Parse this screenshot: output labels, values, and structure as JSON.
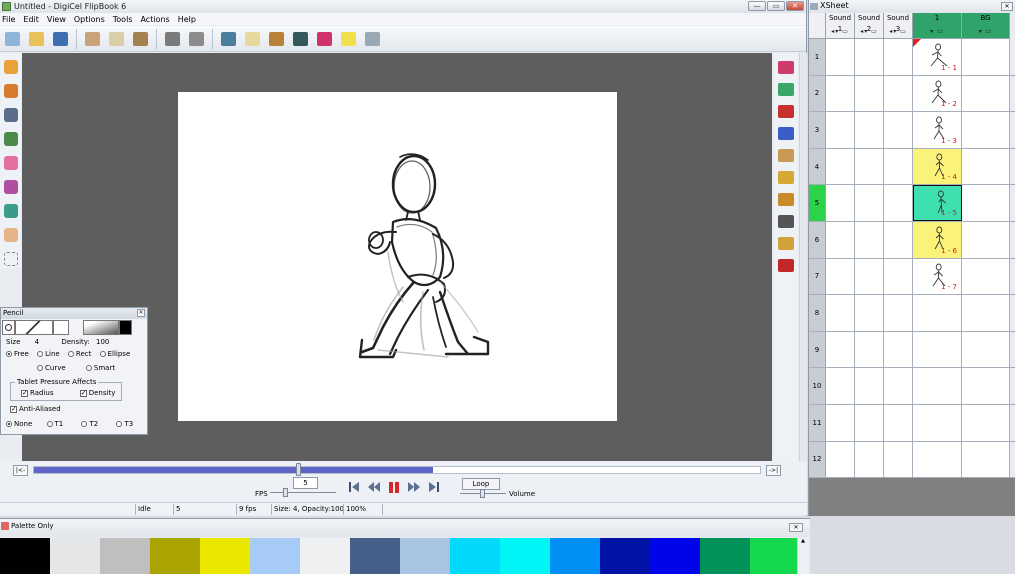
{
  "main_window": {
    "title": "Untitled - DigiCel FlipBook 6",
    "menu": [
      "File",
      "Edit",
      "View",
      "Options",
      "Tools",
      "Actions",
      "Help"
    ]
  },
  "toolbar": {
    "buttons": [
      {
        "icon": "camera-icon",
        "color": "#8fb4d9"
      },
      {
        "icon": "open-folder-icon",
        "color": "#e8c15a"
      },
      {
        "icon": "save-disk-icon",
        "color": "#3d6fb3"
      },
      {
        "icon": "scissors-icon",
        "color": "#c9a27a"
      },
      {
        "icon": "copy-icon",
        "color": "#d9cfa8"
      },
      {
        "icon": "paste-icon",
        "color": "#a58150"
      },
      {
        "icon": "undo-hand-icon",
        "color": "#7b7b7b"
      },
      {
        "icon": "redo-hand-icon",
        "color": "#8b8b8b"
      },
      {
        "icon": "lightbox-icon",
        "color": "#4c7d9c"
      },
      {
        "icon": "eraser-icon",
        "color": "#e6d79b"
      },
      {
        "icon": "palette-icon",
        "color": "#b9803a"
      },
      {
        "icon": "film-icon",
        "color": "#35595a"
      },
      {
        "icon": "ink-icon",
        "color": "#d2326a"
      },
      {
        "icon": "light-bulb-icon",
        "color": "#f1e04c"
      },
      {
        "icon": "wrench-icon",
        "color": "#9aa7b5"
      }
    ]
  },
  "left_tools": [
    {
      "icon": "pencil-icon",
      "color": "#e9a23a"
    },
    {
      "icon": "paint-bucket-icon",
      "color": "#d77a2e"
    },
    {
      "icon": "brush-icon",
      "color": "#5a6d8c"
    },
    {
      "icon": "marker-icon",
      "color": "#4b8a48"
    },
    {
      "icon": "eraser-icon",
      "color": "#e46fa0"
    },
    {
      "icon": "dropper-icon",
      "color": "#b04fa0"
    },
    {
      "icon": "fill-icon",
      "color": "#3b9c8a"
    },
    {
      "icon": "hand-icon",
      "color": "#e7b48a"
    },
    {
      "icon": "selection-icon",
      "color": "#888888"
    }
  ],
  "right_tools": [
    {
      "icon": "flip-page-icon",
      "color": "#cf3b6b"
    },
    {
      "icon": "paint-page-icon",
      "color": "#3aa66a"
    },
    {
      "icon": "ink-page-icon",
      "color": "#c7302f"
    },
    {
      "icon": "blue-page-icon",
      "color": "#3a5ec6"
    },
    {
      "icon": "stack-page-icon",
      "color": "#c99a55"
    },
    {
      "icon": "key-frame-icon",
      "color": "#d6a734"
    },
    {
      "icon": "key-icon",
      "color": "#c98a2a"
    },
    {
      "icon": "arrow-right-icon",
      "color": "#555555"
    },
    {
      "icon": "key-gold-icon",
      "color": "#d1a23a"
    },
    {
      "icon": "arrow-left-icon",
      "color": "#c0282a"
    }
  ],
  "timeline": {
    "start_btn": "|<-",
    "end_btn": "->|",
    "progress": 0.55,
    "fps_label": "FPS",
    "frame_value": "5",
    "loop_label": "Loop",
    "volume_label": "Volume"
  },
  "status": {
    "state": "Idle",
    "frame": "5",
    "fps": "9 fps",
    "size": "Size: 4, Opacity:100",
    "zoom": "100%"
  },
  "pencil_panel": {
    "title": "Pencil",
    "size_label": "Size",
    "size_value": "4",
    "density_label": "Density:",
    "density_value": "100",
    "mode_options": [
      "Free",
      "Line",
      "Rect",
      "Ellipse"
    ],
    "mode_options_2": [
      "Curve",
      "Smart"
    ],
    "pressure_title": "Tablet Pressure Affects",
    "radius_label": "Radius",
    "density_chk_label": "Density",
    "antialias_label": "Anti-Aliased",
    "texture_options": [
      "None",
      "T1",
      "T2",
      "T3"
    ]
  },
  "palette": {
    "title": "Palette Only",
    "colors": [
      "#000000",
      "#e4e6e8",
      "#bfbfbf",
      "#a9a400",
      "#ece700",
      "#a6ccf6",
      "#eff0f2",
      "#446088",
      "#a8c4e2",
      "#00d9fa",
      "#00f5f6",
      "#008ff5",
      "#0013a4",
      "#0004e8",
      "#009258",
      "#14d84e"
    ]
  },
  "xsheet": {
    "title": "XSheet",
    "columns": [
      "Sound 1",
      "Sound 2",
      "Sound 3",
      "1",
      "BG"
    ],
    "current_frame": 5,
    "frames": [
      {
        "num": "1",
        "label": "1 - 1",
        "state": "normal"
      },
      {
        "num": "2",
        "label": "1 - 2",
        "state": "normal"
      },
      {
        "num": "3",
        "label": "1 - 3",
        "state": "normal"
      },
      {
        "num": "4",
        "label": "1 - 4",
        "state": "yellow"
      },
      {
        "num": "5",
        "label": "1 - 5",
        "state": "current"
      },
      {
        "num": "6",
        "label": "1 - 6",
        "state": "yellow"
      },
      {
        "num": "7",
        "label": "1 - 7",
        "state": "normal"
      },
      {
        "num": "8",
        "label": "",
        "state": "empty"
      },
      {
        "num": "9",
        "label": "",
        "state": "empty"
      },
      {
        "num": "10",
        "label": "",
        "state": "empty"
      },
      {
        "num": "11",
        "label": "",
        "state": "empty"
      },
      {
        "num": "12",
        "label": "",
        "state": "empty"
      }
    ]
  }
}
